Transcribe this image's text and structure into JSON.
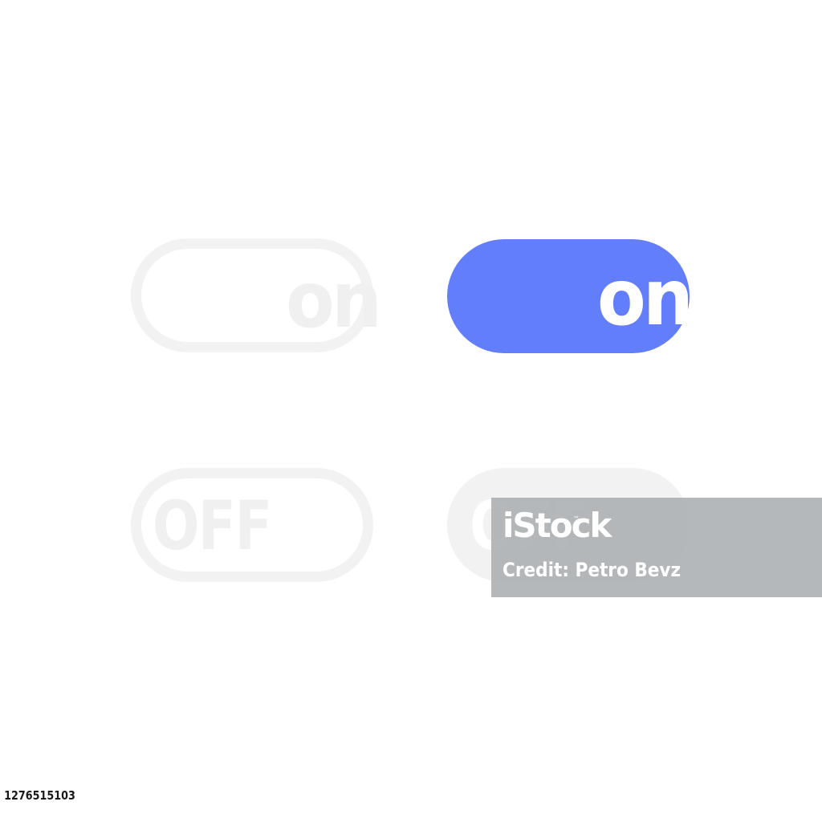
{
  "toggles": [
    {
      "style": "outline",
      "state_label": "on",
      "accent": "#f2f2f2"
    },
    {
      "style": "filled",
      "state_label": "on",
      "accent": "#637efb"
    },
    {
      "style": "outline",
      "state_label": "OFF",
      "accent": "#f2f2f2"
    },
    {
      "style": "filled",
      "state_label": "OFF",
      "accent": "#f2f2f2"
    }
  ],
  "watermark": {
    "brand": "iStock",
    "trademark": "™",
    "credit": "Credit: Petro Bevz"
  },
  "image_id": "1276515103",
  "colors": {
    "background": "#ffffff",
    "accent_blue": "#637efb",
    "light_grey": "#f2f2f2"
  }
}
